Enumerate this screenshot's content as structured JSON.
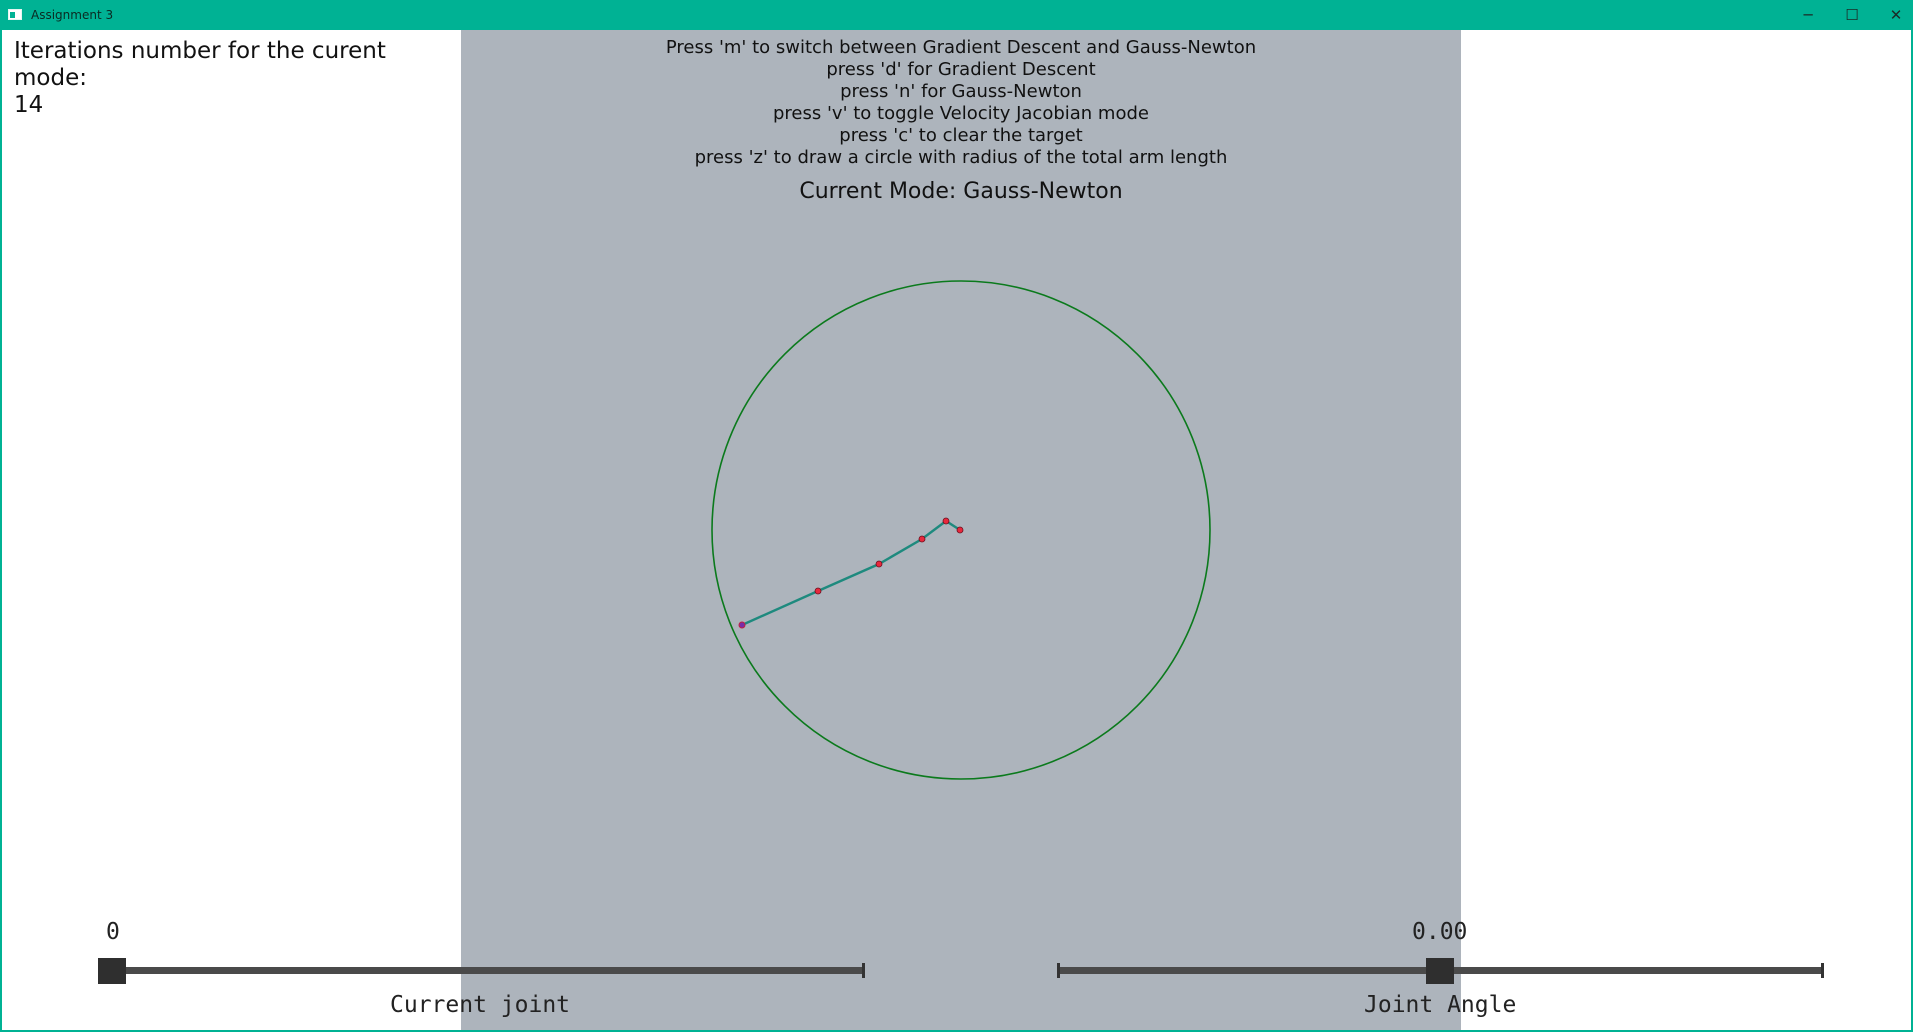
{
  "window": {
    "title": "Assignment 3",
    "minimize_glyph": "─",
    "maximize_glyph": "☐",
    "close_glyph": "✕"
  },
  "iterations": {
    "label": "Iterations number for the curent mode:",
    "value": "14"
  },
  "help": [
    "Press 'm' to switch between Gradient Descent and Gauss-Newton",
    "press 'd' for Gradient Descent",
    "press 'n' for Gauss-Newton",
    "press 'v' to toggle Velocity Jacobian mode",
    "press 'c' to clear the target",
    "press 'z' to draw a circle with radius of the total arm length"
  ],
  "mode": "Current Mode: Gauss-Newton",
  "sliders": {
    "current_joint": {
      "value_text": "0",
      "caption": "Current joint",
      "value": 0,
      "fraction": 0.0
    },
    "joint_angle": {
      "value_text": "0.00",
      "caption": "Joint Angle",
      "value": 0.0,
      "fraction": 0.5
    }
  },
  "colors": {
    "titlebar": "#00b294",
    "viewport": "#adb4bc",
    "circle": "#0b7a1c",
    "arm": "#1e8a7e",
    "joint": "#e8283c",
    "end_effector": "#7a2ca8"
  },
  "icons": {
    "app": "window-app-icon",
    "minimize": "minimize-icon",
    "maximize": "maximize-icon",
    "close": "close-icon"
  }
}
